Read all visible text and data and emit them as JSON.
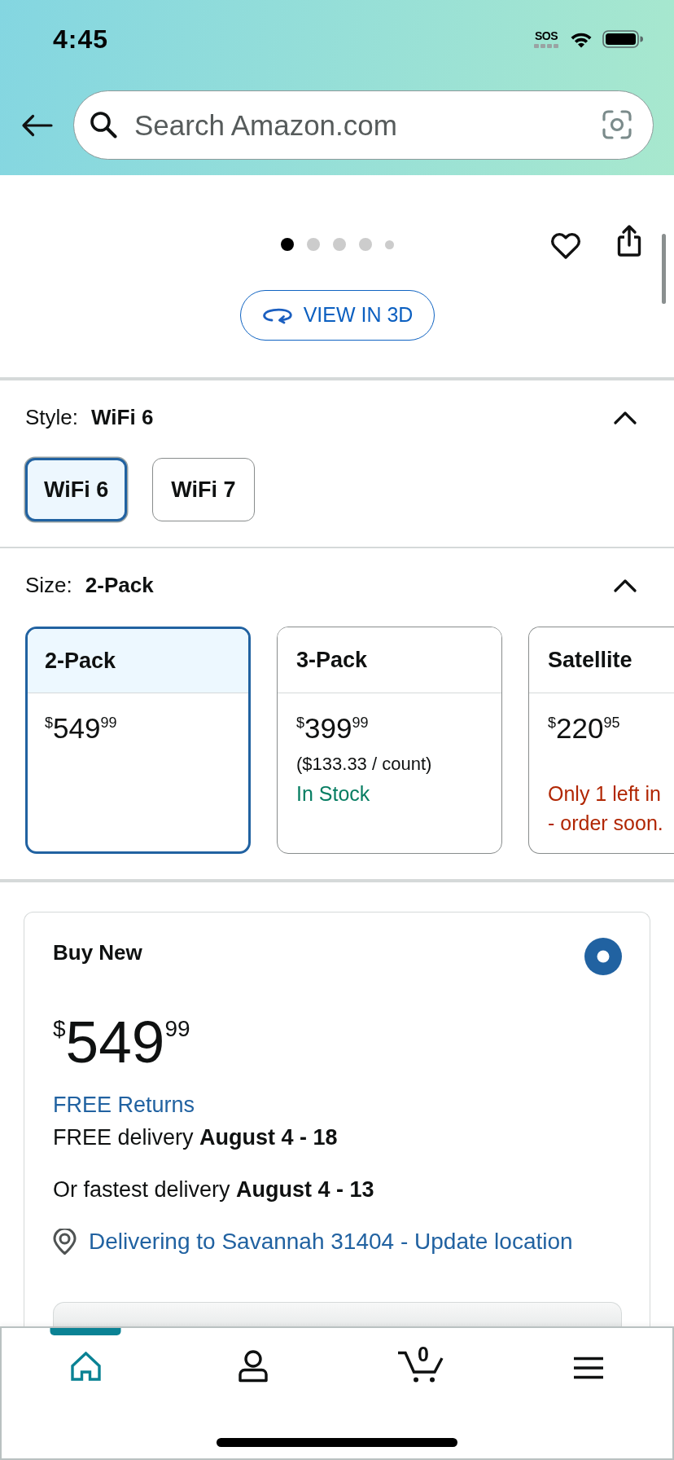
{
  "status_bar": {
    "time": "4:45",
    "sos": "SOS"
  },
  "search": {
    "placeholder": "Search Amazon.com"
  },
  "gallery": {
    "dots": [
      {
        "selected": true
      },
      {
        "selected": false
      },
      {
        "selected": false
      },
      {
        "selected": false
      },
      {
        "selected": false
      }
    ],
    "view_3d": "VIEW IN 3D"
  },
  "variations": [
    {
      "kind": "buttons",
      "label": "Style:",
      "value": "WiFi 6",
      "expanded": true,
      "options": [
        {
          "label": "WiFi 6",
          "selected": true
        },
        {
          "label": "WiFi 7",
          "selected": false
        }
      ]
    },
    {
      "kind": "cards",
      "label": "Size:",
      "value": "2-Pack",
      "expanded": true,
      "options": [
        {
          "label": "2-Pack",
          "selected": true,
          "price": {
            "currency": "$",
            "whole": "549",
            "fraction": "99"
          }
        },
        {
          "label": "3-Pack",
          "selected": false,
          "price": {
            "currency": "$",
            "whole": "399",
            "fraction": "99"
          },
          "unit_price": "($133.33 / count)",
          "availability": {
            "kind": "in_stock",
            "text": "In Stock"
          }
        },
        {
          "label": "Satellite",
          "selected": false,
          "price": {
            "currency": "$",
            "whole": "220",
            "fraction": "95"
          },
          "availability": {
            "kind": "low_stock",
            "text": "Only 1 left in\n- order soon."
          }
        }
      ]
    }
  ],
  "buy_box": {
    "title": "Buy New",
    "selected": true,
    "price": {
      "currency": "$",
      "whole": "549",
      "fraction": "99"
    },
    "returns": "FREE Returns",
    "delivery": "FREE delivery **August 4 - 18**",
    "fastest_delivery": "Or fastest delivery **August 4 - 13**",
    "location": "Delivering to Savannah 31404 - Update location"
  },
  "bottom_nav": [
    {
      "kind": "home",
      "selected": true
    },
    {
      "kind": "account",
      "selected": false
    },
    {
      "kind": "cart",
      "selected": false,
      "count": "0"
    },
    {
      "kind": "menu",
      "selected": false
    }
  ]
}
